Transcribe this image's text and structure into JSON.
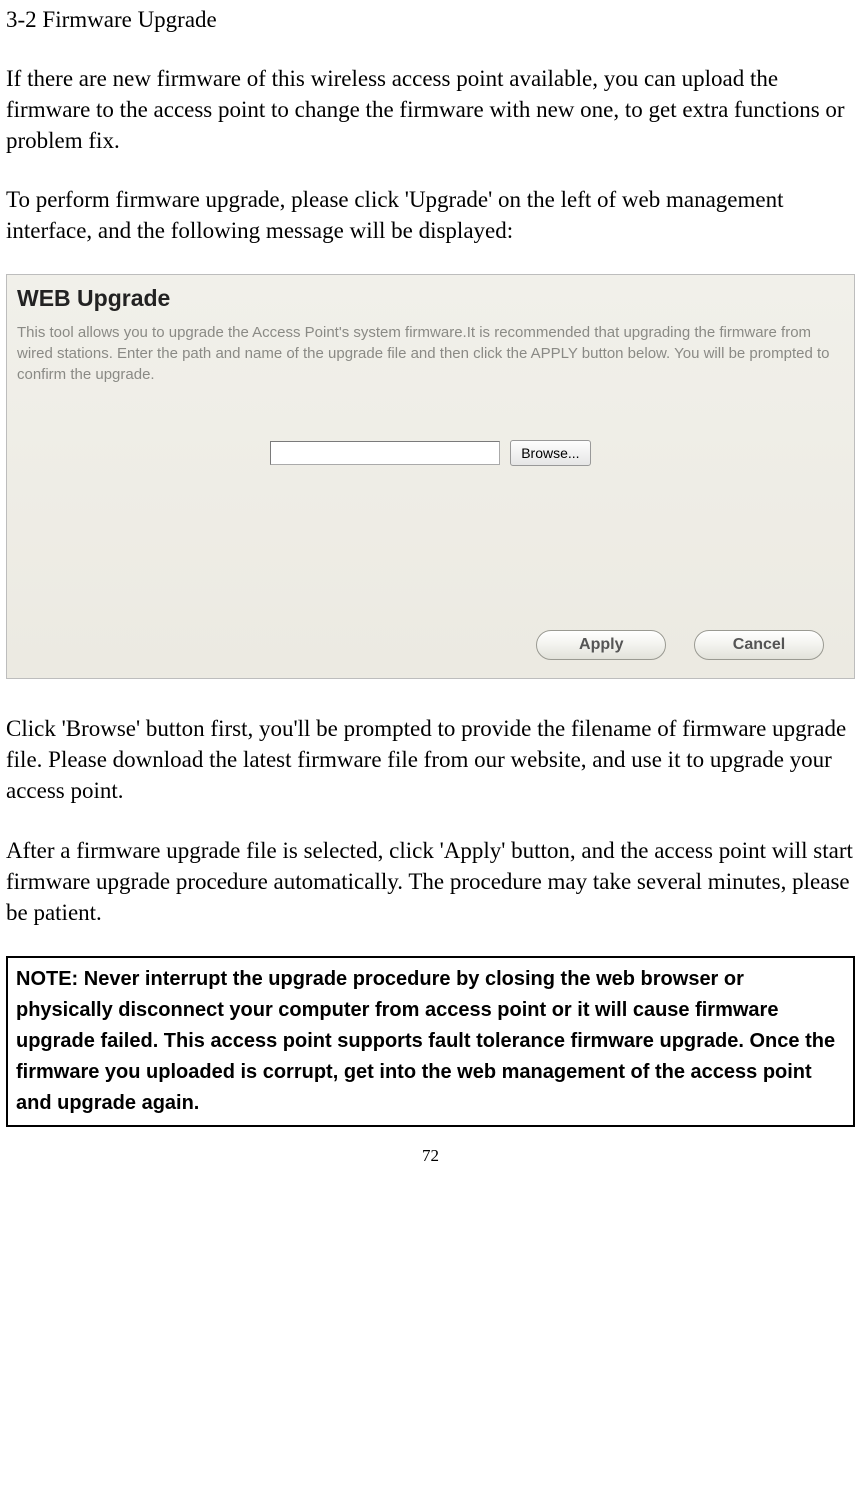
{
  "doc": {
    "heading": "3-2 Firmware Upgrade",
    "p1": "If there are new firmware of this wireless access point available, you can upload the firmware to the access point to change the firmware with new one, to get extra functions or problem fix.",
    "p2": "To perform firmware upgrade, please click 'Upgrade' on the left of web management interface, and the following message will be displayed:",
    "p3": "Click 'Browse' button first, you'll be prompted to provide the filename of firmware upgrade file. Please download the latest firmware file from our website, and use it to upgrade your access point.",
    "p4": "After a firmware upgrade file is selected, click 'Apply' button, and the access point will start firmware upgrade procedure automatically. The procedure may take several minutes, please be patient.",
    "note": "NOTE: Never interrupt the upgrade procedure by closing the web browser or physically disconnect your computer from access point or it will cause firmware upgrade failed. This access point supports fault tolerance firmware upgrade. Once the firmware you uploaded is corrupt, get into the web management of the access point and upgrade again.",
    "pagenum": "72"
  },
  "screenshot": {
    "title": "WEB Upgrade",
    "desc": "This tool allows you to upgrade the Access Point's system firmware.It is recommended that upgrading the firmware from wired stations.\nEnter the path and name of the upgrade file and then click the APPLY button below. You will be prompted to confirm the upgrade.",
    "file_value": "",
    "browse_label": "Browse...",
    "apply_label": "Apply",
    "cancel_label": "Cancel"
  }
}
